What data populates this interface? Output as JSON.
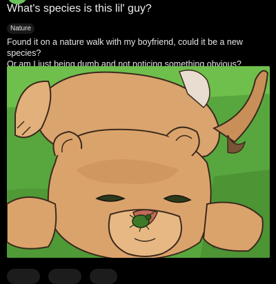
{
  "post": {
    "title": "What's species is this lil' guy?",
    "flair": "Nature",
    "body_line1": "Found it on a nature walk with my boyfriend, could it be a new species?",
    "body_line2": "Or am I just being dumb and not noticing something obvious?"
  },
  "colors": {
    "background": "#000000",
    "flair_bg": "#1a1a1b",
    "grass": "#5aa640",
    "fur": "#d9a46e"
  },
  "icons": [
    "bug-icon"
  ]
}
